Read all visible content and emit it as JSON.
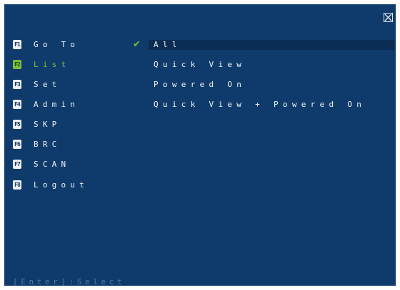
{
  "close_icon": "close-x-icon",
  "menu": {
    "items": [
      {
        "key": "F1",
        "label": "Go To",
        "active": false
      },
      {
        "key": "F2",
        "label": "List",
        "active": true
      },
      {
        "key": "F3",
        "label": "Set",
        "active": false
      },
      {
        "key": "F4",
        "label": "Admin",
        "active": false
      },
      {
        "key": "F5",
        "label": "SKP",
        "active": false
      },
      {
        "key": "F6",
        "label": "BRC",
        "active": false
      },
      {
        "key": "F7",
        "label": "SCAN",
        "active": false
      },
      {
        "key": "F8",
        "label": "Logout",
        "active": false
      }
    ]
  },
  "list": {
    "options": [
      {
        "label": "All",
        "selected": true
      },
      {
        "label": "Quick View",
        "selected": false
      },
      {
        "label": "Powered On",
        "selected": false
      },
      {
        "label": "Quick View + Powered On",
        "selected": false
      }
    ],
    "check_icon": "checkmark-icon"
  },
  "footer": {
    "hint": "[Enter]:Select"
  },
  "colors": {
    "background": "#0e3b6b",
    "accent": "#7cbf3c",
    "text": "#f3f3f3",
    "hint": "#4f7aa8",
    "selected_bar": "#0a2c54"
  }
}
